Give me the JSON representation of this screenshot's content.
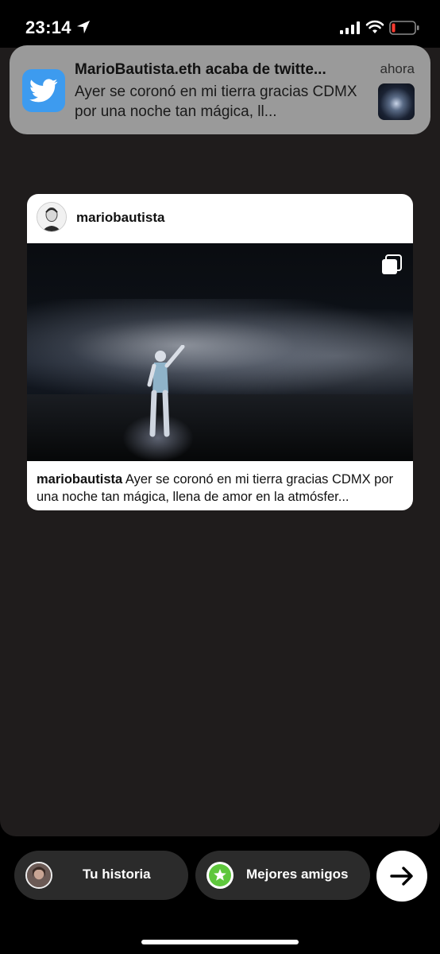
{
  "status_bar": {
    "time": "23:14",
    "icons": [
      "location-arrow-icon",
      "cellular-signal-icon",
      "wifi-icon",
      "battery-low-icon"
    ],
    "battery_color": "#ff3b30"
  },
  "notification": {
    "app_icon": "twitter-bird-icon",
    "title": "MarioBautista.eth acaba de twitte...",
    "time": "ahora",
    "body": "Ayer se coronó en mi tierra gracias CDMX por una noche tan mágica, ll...",
    "accent": "#3d9bef"
  },
  "post": {
    "username": "mariobautista",
    "caption_user": "mariobautista",
    "caption_text": " Ayer se coronó en mi tierra gracias CDMX por una noche tan mágica, llena de amor en la atmósfer...",
    "multi_icon": "carousel-multiple-icon"
  },
  "bottom_bar": {
    "your_story": "Tu historia",
    "close_friends": "Mejores amigos",
    "close_friends_color": "#5ec73c",
    "send_icon": "arrow-right-icon"
  }
}
